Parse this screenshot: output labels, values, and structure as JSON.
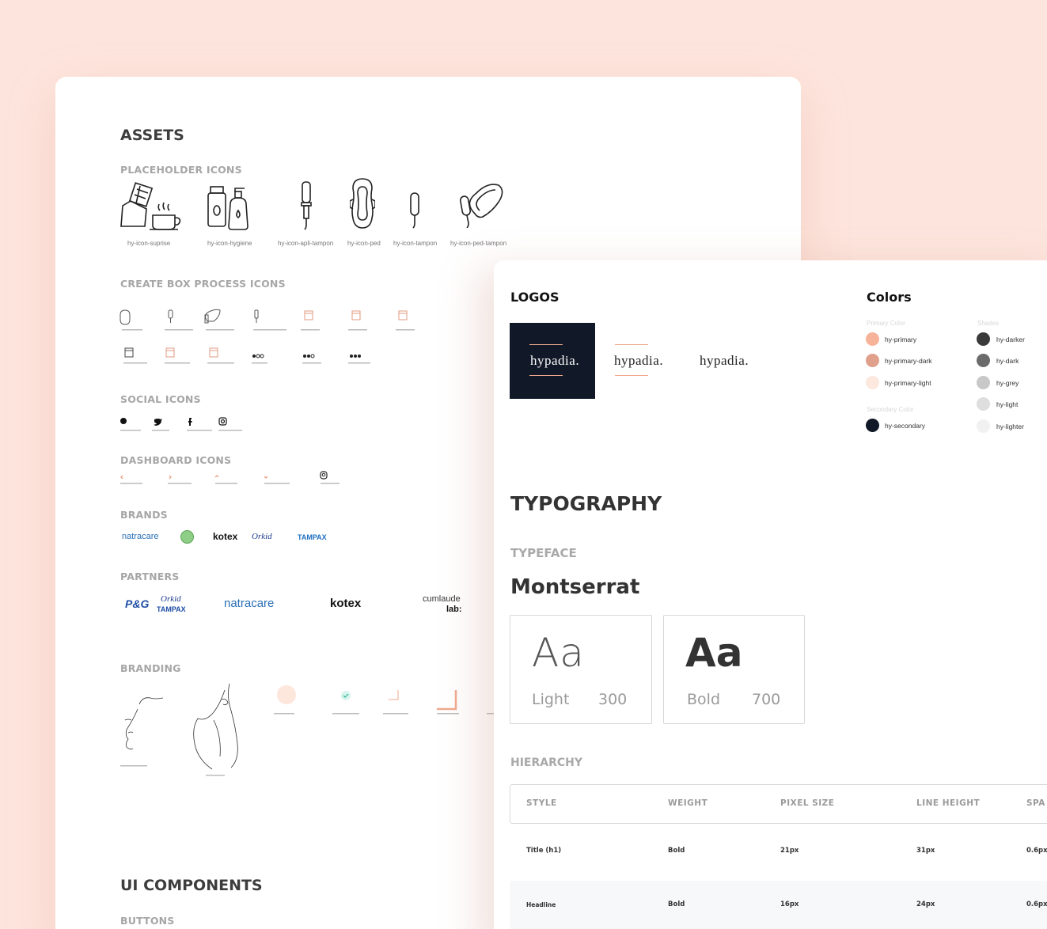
{
  "assets": {
    "title": "ASSETS",
    "placeholder_title": "PLACEHOLDER ICONS",
    "placeholder_icons": [
      "hy-icon-suprise",
      "hy-icon-hygiene",
      "hy-icon-apli-tampon",
      "hy-icon-ped",
      "hy-icon-tampon",
      "hy-icon-ped-tampon"
    ],
    "box_process_title": "CREATE BOX PROCESS ICONS",
    "social_title": "SOCIAL ICONS",
    "dashboard_title": "DASHBOARD ICONS",
    "brands_title": "BRANDS",
    "brands": [
      "natracare",
      "kotex",
      "Orkid",
      "TAMPAX"
    ],
    "partners_title": "PARTNERS",
    "partners": [
      "P&G",
      "Orkid",
      "TAMPAX",
      "natracare",
      "kotex",
      "cumlaude",
      "lab:"
    ],
    "branding_title": "BRANDING",
    "ui_components_title": "UI COMPONENTS",
    "buttons_title": "BUTTONS"
  },
  "logos": {
    "title": "LOGOS",
    "wordmark": "hypadia."
  },
  "colors": {
    "title": "Colors",
    "primary_title": "Primary Color",
    "primary": [
      {
        "name": "hy-primary",
        "hex": "#f7b29a"
      },
      {
        "name": "hy-primary-dark",
        "hex": "#e0a08b"
      },
      {
        "name": "hy-primary-light",
        "hex": "#fde8e0"
      }
    ],
    "secondary_title": "Secondary Color",
    "secondary": [
      {
        "name": "hy-secondary",
        "hex": "#111827"
      }
    ],
    "shades_title": "Shades",
    "shades": [
      {
        "name": "hy-darker",
        "hex": "#3a3a3a"
      },
      {
        "name": "hy-dark",
        "hex": "#6b6b6b"
      },
      {
        "name": "hy-grey",
        "hex": "#c8c8c8"
      },
      {
        "name": "hy-light",
        "hex": "#dedede"
      },
      {
        "name": "hy-lighter",
        "hex": "#f1f1f1"
      }
    ]
  },
  "typography": {
    "title": "TYPOGRAPHY",
    "typeface_title": "TYPEFACE",
    "typeface": "Montserrat",
    "samples": [
      {
        "glyph": "Aa",
        "name": "Light",
        "weight": "300"
      },
      {
        "glyph": "Aa",
        "name": "Bold",
        "weight": "700"
      }
    ],
    "hierarchy_title": "HIERARCHY",
    "columns": [
      "STYLE",
      "WEIGHT",
      "PIXEL SIZE",
      "LINE HEIGHT",
      "SPA"
    ],
    "rows": [
      [
        "Title (h1)",
        "Bold",
        "21px",
        "31px",
        "0.6px"
      ],
      [
        "Headline",
        "Bold",
        "16px",
        "24px",
        "0.6px"
      ]
    ]
  }
}
